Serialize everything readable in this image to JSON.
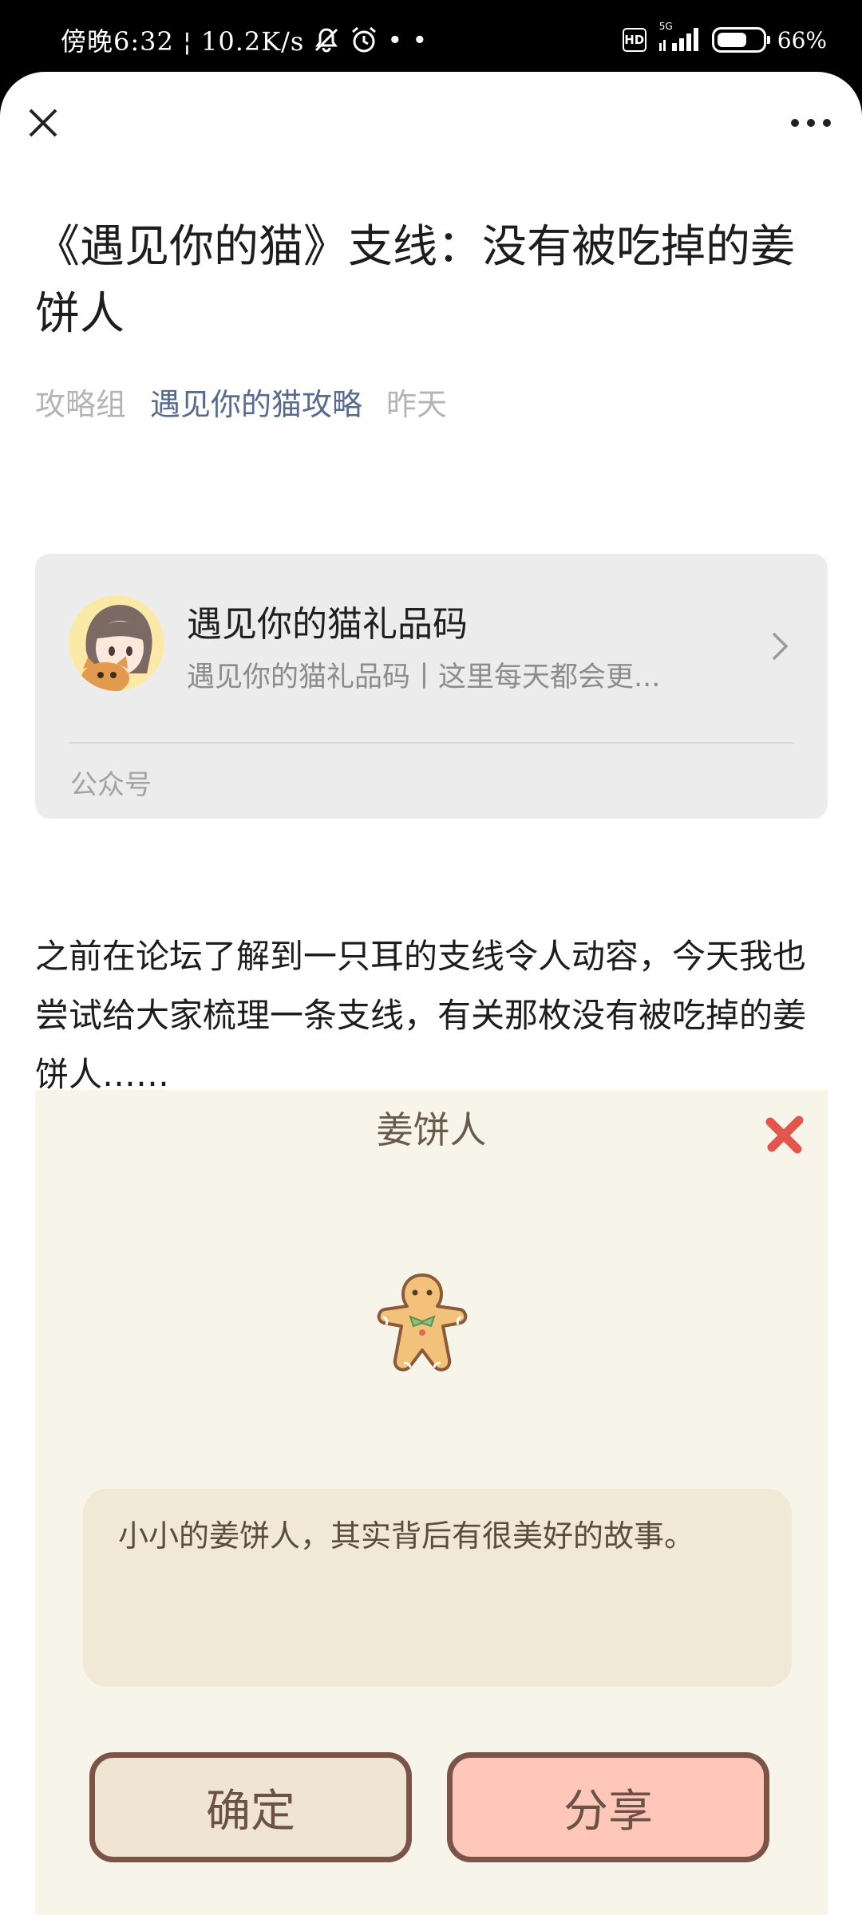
{
  "status_bar": {
    "time_speed": "傍晚6:32 ¦ 10.2K/s",
    "dots": "• •",
    "hd": "HD",
    "network": "5G",
    "battery": "66%",
    "battery_level": 0.66,
    "icons": [
      "mute-bell-icon",
      "alarm-icon",
      "hd-icon",
      "signal-icon",
      "battery-icon"
    ]
  },
  "top_bar": {
    "close_icon": "close-icon",
    "more_icon": "more-icon"
  },
  "article": {
    "title": "《遇见你的猫》支线：没有被吃掉的姜饼人",
    "group": "攻略组",
    "account": "遇见你的猫攻略",
    "time": "昨天",
    "body": "之前在论坛了解到一只耳的支线令人动容，今天我也尝试给大家梳理一条支线，有关那枚没有被吃掉的姜饼人……"
  },
  "profile_card": {
    "name": "遇见你的猫礼品码",
    "description": "遇见你的猫礼品码丨这里每天都会更...",
    "type": "公众号"
  },
  "game_screenshot": {
    "title": "姜饼人",
    "description": "小小的姜饼人，其实背后有很美好的故事。",
    "confirm": "确定",
    "share": "分享"
  },
  "colors": {
    "account_link": "#566b8f",
    "card_bg": "#ececec",
    "game_bg": "#f7f4ea",
    "share_btn": "#fec7ba",
    "close_red": "#e3564e"
  }
}
